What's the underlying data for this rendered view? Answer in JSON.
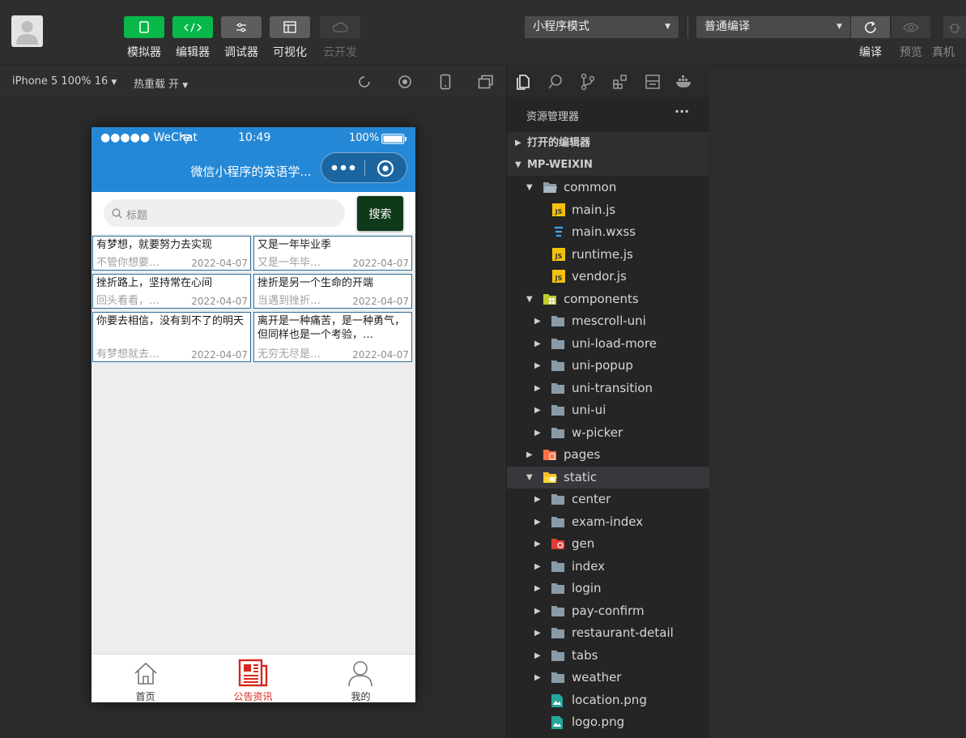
{
  "toolbar": {
    "buttons": [
      {
        "label": "模拟器",
        "icon": "phone-icon"
      },
      {
        "label": "编辑器",
        "icon": "code-icon"
      },
      {
        "label": "调试器",
        "icon": "debug-icon"
      },
      {
        "label": "可视化",
        "icon": "layout-icon"
      },
      {
        "label": "云开发",
        "icon": "cloud-icon"
      }
    ],
    "mode_select": "小程序模式",
    "compile_select": "普通编译",
    "right_labels": [
      "编译",
      "预览",
      "真机"
    ]
  },
  "simbar": {
    "device": "iPhone 5 100% 16",
    "hot_reload": "热重载 开"
  },
  "phone": {
    "status": {
      "carrier": "●●●●● WeChat",
      "time": "10:49",
      "battery": "100%"
    },
    "nav_title": "微信小程序的英语学...",
    "search": {
      "placeholder": "标题",
      "button": "搜索"
    },
    "cards": [
      {
        "title": "有梦想，就要努力去实现",
        "sub": "不管你想要…",
        "date": "2022-04-07"
      },
      {
        "title": "又是一年毕业季",
        "sub": "又是一年毕…",
        "date": "2022-04-07"
      },
      {
        "title": "挫折路上，坚持常在心间",
        "sub": "回头看看，…",
        "date": "2022-04-07"
      },
      {
        "title": "挫折是另一个生命的开端",
        "sub": "当遇到挫折…",
        "date": "2022-04-07"
      },
      {
        "title": "你要去相信，没有到不了的明天",
        "sub": "有梦想就去…",
        "date": "2022-04-07"
      },
      {
        "title": "离开是一种痛苦，是一种勇气，但同样也是一个考验，…",
        "sub": "无穷无尽是…",
        "date": "2022-04-07"
      }
    ],
    "tabs": [
      {
        "label": "首页",
        "icon": "home-icon",
        "active": false
      },
      {
        "label": "公告资讯",
        "icon": "news-icon",
        "active": true
      },
      {
        "label": "我的",
        "icon": "user-icon",
        "active": false
      }
    ]
  },
  "explorer": {
    "title": "资源管理器",
    "more": "···",
    "sections": {
      "open_editors": "打开的编辑器",
      "project": "MP-WEIXIN"
    },
    "tree": [
      {
        "label": "common",
        "type": "folder-open",
        "depth": 1,
        "expanded": true
      },
      {
        "label": "main.js",
        "type": "js",
        "depth": 2
      },
      {
        "label": "main.wxss",
        "type": "css",
        "depth": 2
      },
      {
        "label": "runtime.js",
        "type": "js",
        "depth": 2
      },
      {
        "label": "vendor.js",
        "type": "js",
        "depth": 2
      },
      {
        "label": "components",
        "type": "folder-components",
        "depth": 1,
        "expanded": true
      },
      {
        "label": "mescroll-uni",
        "type": "folder",
        "depth": 2
      },
      {
        "label": "uni-load-more",
        "type": "folder",
        "depth": 2
      },
      {
        "label": "uni-popup",
        "type": "folder",
        "depth": 2
      },
      {
        "label": "uni-transition",
        "type": "folder",
        "depth": 2
      },
      {
        "label": "uni-ui",
        "type": "folder",
        "depth": 2
      },
      {
        "label": "w-picker",
        "type": "folder",
        "depth": 2
      },
      {
        "label": "pages",
        "type": "folder-pages",
        "depth": 1
      },
      {
        "label": "static",
        "type": "folder-static",
        "depth": 1,
        "expanded": true,
        "selected": true
      },
      {
        "label": "center",
        "type": "folder",
        "depth": 2
      },
      {
        "label": "exam-index",
        "type": "folder",
        "depth": 2
      },
      {
        "label": "gen",
        "type": "folder-gen",
        "depth": 2
      },
      {
        "label": "index",
        "type": "folder",
        "depth": 2
      },
      {
        "label": "login",
        "type": "folder",
        "depth": 2
      },
      {
        "label": "pay-confirm",
        "type": "folder",
        "depth": 2
      },
      {
        "label": "restaurant-detail",
        "type": "folder",
        "depth": 2
      },
      {
        "label": "tabs",
        "type": "folder",
        "depth": 2
      },
      {
        "label": "weather",
        "type": "folder",
        "depth": 2
      },
      {
        "label": "location.png",
        "type": "image",
        "depth": 2
      },
      {
        "label": "logo.png",
        "type": "image",
        "depth": 2
      }
    ]
  },
  "colors": {
    "accent_green": "#08b84a",
    "nav_blue": "#2488d7",
    "tab_active": "#d9261c",
    "search_btn": "#0f3a1a"
  }
}
